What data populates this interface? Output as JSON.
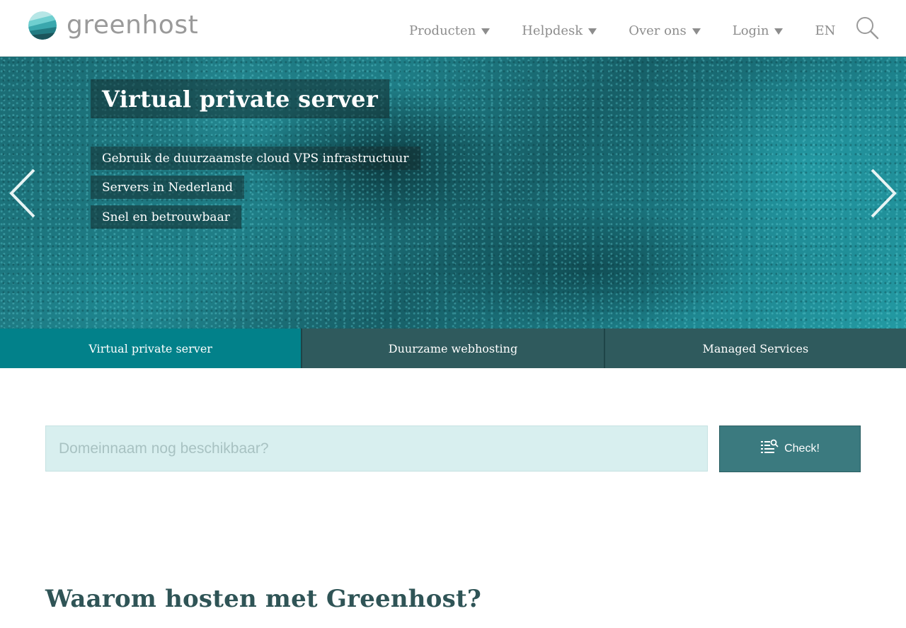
{
  "brand": {
    "name": "greenhost",
    "logo_icon": "layered-sphere-logo",
    "colors": {
      "teal_dark": "#2f5a5d",
      "teal_active": "#02818a",
      "teal_button": "#3b7a7f",
      "input_bg": "#d8efef",
      "heading": "#2f5456"
    }
  },
  "nav": {
    "items": [
      {
        "label": "Producten",
        "icon": "caret-down-icon"
      },
      {
        "label": "Helpdesk",
        "icon": "caret-down-icon"
      },
      {
        "label": "Over ons",
        "icon": "caret-down-icon"
      },
      {
        "label": "Login",
        "icon": "caret-down-icon"
      }
    ],
    "language": "EN",
    "search_icon": "search-icon"
  },
  "hero": {
    "title": "Virtual private server",
    "lines": [
      "Gebruik de duurzaamste cloud VPS infrastructuur",
      "Servers in Nederland",
      "Snel en betrouwbaar"
    ],
    "prev_icon": "chevron-left-icon",
    "next_icon": "chevron-right-icon"
  },
  "tabs": [
    {
      "label": "Virtual private server",
      "active": true
    },
    {
      "label": "Duurzame webhosting",
      "active": false
    },
    {
      "label": "Managed Services",
      "active": false
    }
  ],
  "domain_search": {
    "placeholder": "Domeinnaam nog beschikbaar?",
    "value": "",
    "button_label": "Check!",
    "button_icon": "list-search-icon"
  },
  "section": {
    "title": "Waarom hosten met Greenhost?"
  }
}
